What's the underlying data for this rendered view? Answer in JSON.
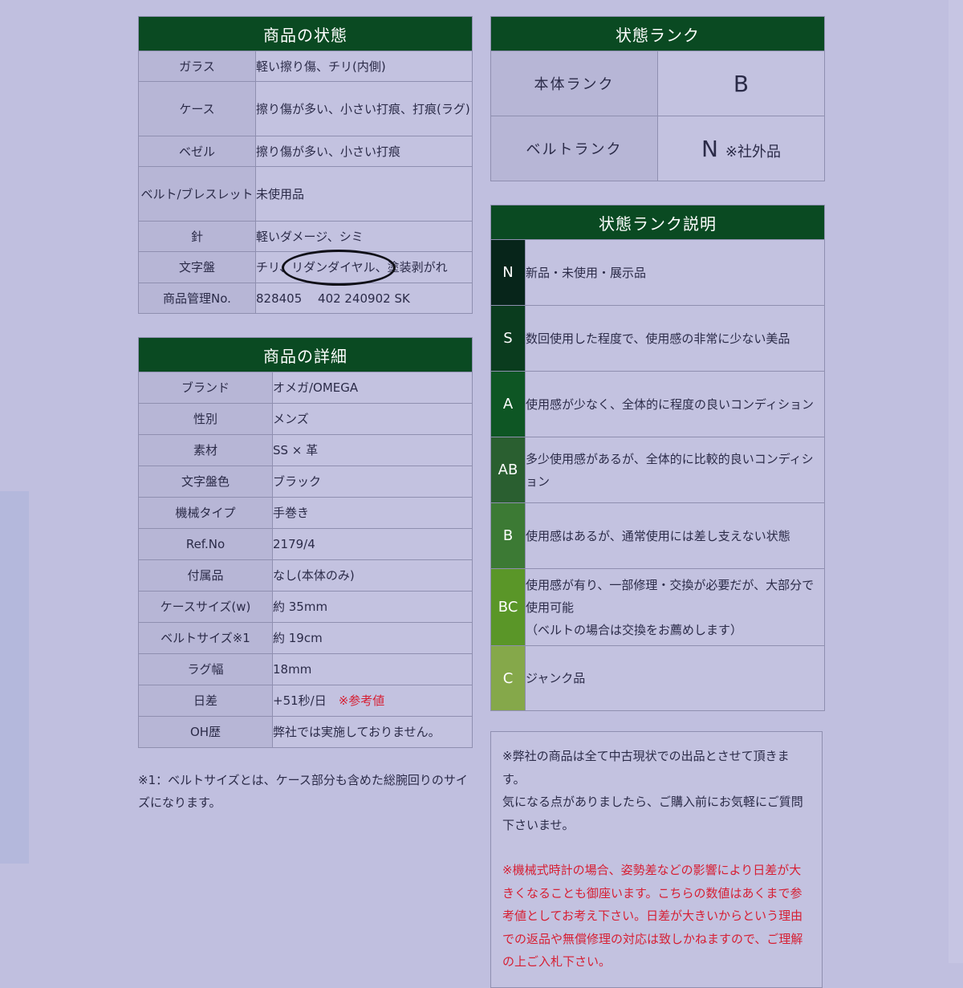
{
  "condition": {
    "title": "商品の状態",
    "rows": [
      {
        "label": "ガラス",
        "value": "軽い擦り傷、チリ(内側)"
      },
      {
        "label": "ケース",
        "value": "擦り傷が多い、小さい打痕、打痕(ラグ)"
      },
      {
        "label": "ベゼル",
        "value": "擦り傷が多い、小さい打痕"
      },
      {
        "label": "ベルト/ブレスレット",
        "value": "未使用品"
      },
      {
        "label": "針",
        "value": "軽いダメージ、シミ"
      },
      {
        "label": "文字盤",
        "value_parts": [
          "チリ、",
          "リダンダイヤル、",
          "塗装剥がれ"
        ]
      },
      {
        "label": "商品管理No.",
        "value": "828405　 402 240902 SK"
      }
    ]
  },
  "details": {
    "title": "商品の詳細",
    "rows": [
      {
        "label": "ブランド",
        "value": "オメガ/OMEGA"
      },
      {
        "label": "性別",
        "value": "メンズ"
      },
      {
        "label": "素材",
        "value": "SS × 革"
      },
      {
        "label": "文字盤色",
        "value": "ブラック"
      },
      {
        "label": "機械タイプ",
        "value": "手巻き"
      },
      {
        "label": "Ref.No",
        "value": "2179/4"
      },
      {
        "label": "付属品",
        "value": "なし(本体のみ)"
      },
      {
        "label": "ケースサイズ(w)",
        "value": "約 35mm"
      },
      {
        "label": "ベルトサイズ※1",
        "value": "約 19cm"
      },
      {
        "label": "ラグ幅",
        "value": "18mm"
      },
      {
        "label": "日差",
        "value": "+51秒/日",
        "note": "※参考値"
      },
      {
        "label": "OH歴",
        "value": "弊社では実施しておりません。"
      }
    ]
  },
  "footnote": "※1：ベルトサイズとは、ケース部分も含めた総腕回りのサイズになります。",
  "rank": {
    "title": "状態ランク",
    "body_label": "本体ランク",
    "body_value": "B",
    "belt_label": "ベルトランク",
    "belt_value": "N",
    "belt_note": "※社外品"
  },
  "rank_desc": {
    "title": "状態ランク説明",
    "rows": [
      {
        "letter": "N",
        "color": "#07251a",
        "text": "新品・未使用・展示品"
      },
      {
        "letter": "S",
        "color": "#0a3c1e",
        "text": "数回使用した程度で、使用感の非常に少ない美品"
      },
      {
        "letter": "A",
        "color": "#0e5624",
        "text": "使用感が少なく、全体的に程度の良いコンディション"
      },
      {
        "letter": "AB",
        "color": "#2a5f30",
        "text": "多少使用感があるが、全体的に比較的良いコンディション"
      },
      {
        "letter": "B",
        "color": "#3c7a34",
        "text": "使用感はあるが、通常使用には差し支えない状態"
      },
      {
        "letter": "BC",
        "color": "#5a9628",
        "text_lines": [
          "使用感が有り、一部修理・交換が必要だが、大部分で使用可能",
          "（ベルトの場合は交換をお薦めします）"
        ]
      },
      {
        "letter": "C",
        "color": "#85a84a",
        "text": "ジャンク品"
      }
    ]
  },
  "notice": {
    "p1": "※弊社の商品は全て中古現状での出品とさせて頂きます。",
    "p2": "気になる点がありましたら、ご購入前にお気軽にご質問下さいませ。",
    "p3": "※機械式時計の場合、姿勢差などの影響により日差が大きくなることも御座います。こちらの数値はあくまで参考値としてお考え下さい。日差が大きいからという理由での返品や無償修理の対応は致しかねますので、ご理解の上ご入札下さい。"
  }
}
